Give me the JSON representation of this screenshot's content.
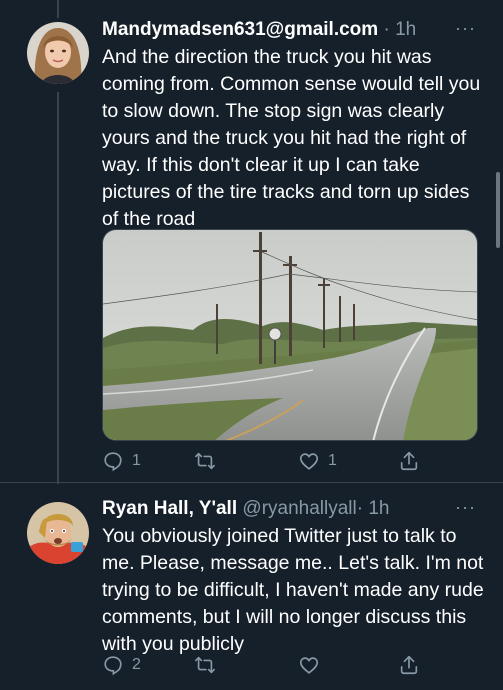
{
  "tweets": [
    {
      "display_name": "Mandymadsen631@gmail.com",
      "handle": "",
      "separator": "·",
      "time": "1h",
      "more": "···",
      "text": "And the direction the truck you hit was coming from. Common sense would tell you to slow down. The stop sign was clearly yours and the truck you hit had the right of way. If this don't clear it up I can take pictures of the tire tracks and torn up sides of the road",
      "media": "road-photo",
      "replies": "1",
      "retweets": "",
      "likes": "1"
    },
    {
      "display_name": "Ryan Hall, Y'all",
      "handle": "@ryanhallyall",
      "separator": "·",
      "time": "1h",
      "more": "···",
      "text": "You obviously joined Twitter just to talk to me. Please, message me.. Let's talk. I'm not trying to be difficult, I haven't made any rude comments, but I will no longer discuss this with you publicly",
      "replies": "2",
      "retweets": "",
      "likes": ""
    }
  ],
  "colors": {
    "background": "#15202b",
    "muted": "#8899a6",
    "divider": "#38444d"
  },
  "icons": [
    "reply-icon",
    "retweet-icon",
    "like-icon",
    "share-icon",
    "more-icon"
  ]
}
